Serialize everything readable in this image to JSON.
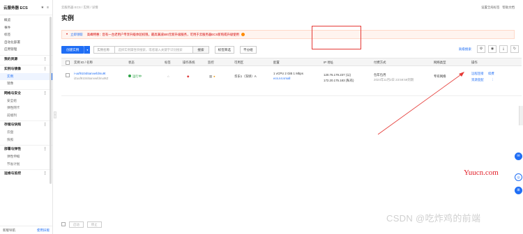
{
  "sidebar": {
    "title": "云服务器 ECS",
    "items": [
      {
        "label": "概览",
        "type": "item"
      },
      {
        "label": "事件",
        "type": "item"
      },
      {
        "label": "标签",
        "type": "item"
      },
      {
        "label": "自动化部署",
        "type": "item"
      },
      {
        "label": "应用管理",
        "type": "item"
      },
      {
        "label": "我的资源",
        "type": "group"
      },
      {
        "label": "实例与镜像",
        "type": "group"
      },
      {
        "label": "实例",
        "type": "sub",
        "active": true
      },
      {
        "label": "镜像",
        "type": "sub"
      },
      {
        "label": "网络与安全",
        "type": "group"
      },
      {
        "label": "安全组",
        "type": "sub"
      },
      {
        "label": "弹性网卡",
        "type": "sub"
      },
      {
        "label": "前缀列",
        "type": "sub"
      },
      {
        "label": "存储与快照",
        "type": "group"
      },
      {
        "label": "云盘",
        "type": "sub"
      },
      {
        "label": "快照",
        "type": "sub"
      },
      {
        "label": "部署与弹性",
        "type": "group"
      },
      {
        "label": "弹性伸缩",
        "type": "sub"
      },
      {
        "label": "节省计划",
        "type": "sub"
      },
      {
        "label": "运维与监控",
        "type": "group"
      }
    ],
    "footer_left": "新版导航",
    "footer_right": "使用旧版"
  },
  "header": {
    "breadcrumb": "云服务器 ECS  /  实例  /  详情",
    "page_title": "实例",
    "top_links": [
      "设置全局标签",
      "帮助文档"
    ]
  },
  "notice": {
    "link": "立即领取",
    "text": "高峰特惠：您有一台老用户专享升级体验权限，最高满减500元新升级服务，可用于云服务器ECS新购或升级使用"
  },
  "toolbar": {
    "create_label": "创建实例",
    "search_field": "实例名称",
    "search_placeholder": "选择实例属性项搜索，或者输入关键字识别搜索",
    "search_button": "搜索",
    "tag_filter": "标签筛选",
    "more_filter": "不分组",
    "advanced": "高级搜索"
  },
  "table": {
    "columns": [
      "实例 ID / 名称",
      "状态",
      "标签",
      "操作系统",
      "监控",
      "可用区",
      "配置",
      "IP 地址",
      "付费方式",
      "网络类型",
      "操作"
    ],
    "rows": [
      {
        "instance_id": "i-uuf9104i5anvwfdmu9t",
        "instance_name": "iZuuf9104i5anvwfdmu9tZ",
        "status": "运行中",
        "zone": "华东1（深圳）A",
        "config": "1 vCPU  2 GiB  1 Mbps",
        "spec": "ecs.n4.small",
        "ip_public": "120.76.179.237 (公)",
        "ip_private": "172.20.175.183 (私有)",
        "billing": "包年包月",
        "billing_detail": "2024年11月2日 23:59:59到期",
        "network": "专有网络",
        "actions": [
          "远程连接",
          "续费",
          "资源变配",
          "⋮"
        ]
      }
    ]
  },
  "bottom": {
    "buttons": [
      "启动",
      "停止"
    ]
  },
  "watermarks": {
    "site": "Yuucn.com",
    "csdn": "CSDN @吃炸鸡的前端"
  },
  "colors": {
    "primary": "#1f6ef5",
    "notice_red": "#d40000",
    "running_green": "#2ba245",
    "highlight_box": "#e53935"
  }
}
